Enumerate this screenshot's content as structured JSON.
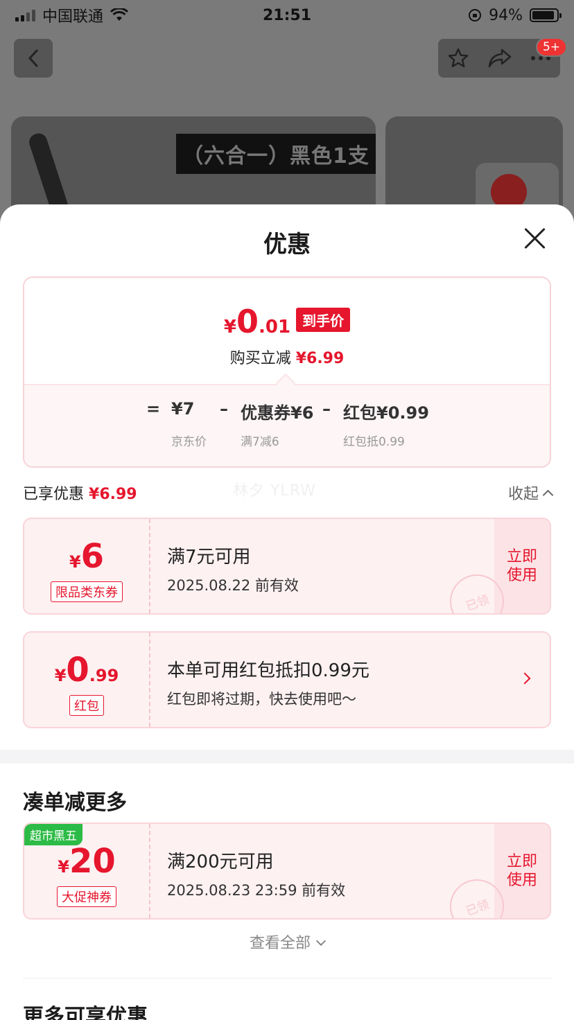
{
  "status_bar": {
    "carrier": "中国联通",
    "time": "21:51",
    "battery": "94%"
  },
  "nav": {
    "badge": "5+"
  },
  "background": {
    "banner_text": "（六合一）黑色1支"
  },
  "sheet": {
    "title": "优惠",
    "final_price": {
      "yen": "¥",
      "integer": "0",
      "decimal": ".01",
      "tag": "到手价"
    },
    "reduce": {
      "label": "购买立减",
      "amount": "¥6.99"
    },
    "formula": {
      "equals": "=",
      "jd_price": "¥7",
      "jd_price_label": "京东价",
      "minus1": "–",
      "coupon": "优惠券¥6",
      "coupon_label": "满7减6",
      "minus2": "–",
      "hongbao": "红包¥0.99",
      "hongbao_label": "红包抵0.99"
    },
    "enjoyed": {
      "label": "已享优惠",
      "amount": "¥6.99",
      "collapse": "收起"
    },
    "watermark": "林夕 YLRW",
    "coupons": [
      {
        "yen": "¥",
        "amount": "6",
        "decimal": "",
        "tag": "限品类东券",
        "title": "满7元可用",
        "sub": "2025.08.22 前有效",
        "action": "立即使用",
        "stamp": "已领"
      },
      {
        "yen": "¥",
        "amount": "0",
        "decimal": ".99",
        "tag": "红包",
        "title": "本单可用红包抵扣0.99元",
        "sub": "红包即将过期，快去使用吧～"
      }
    ],
    "more_section": {
      "title": "凑单减更多",
      "coupon": {
        "promo": "超市黑五",
        "yen": "¥",
        "amount": "20",
        "tag": "大促神券",
        "title": "满200元可用",
        "sub": "2025.08.23 23:59 前有效",
        "action": "立即使用",
        "stamp": "已领"
      },
      "view_all": "查看全部"
    },
    "more_offers_title": "更多可享优惠"
  }
}
